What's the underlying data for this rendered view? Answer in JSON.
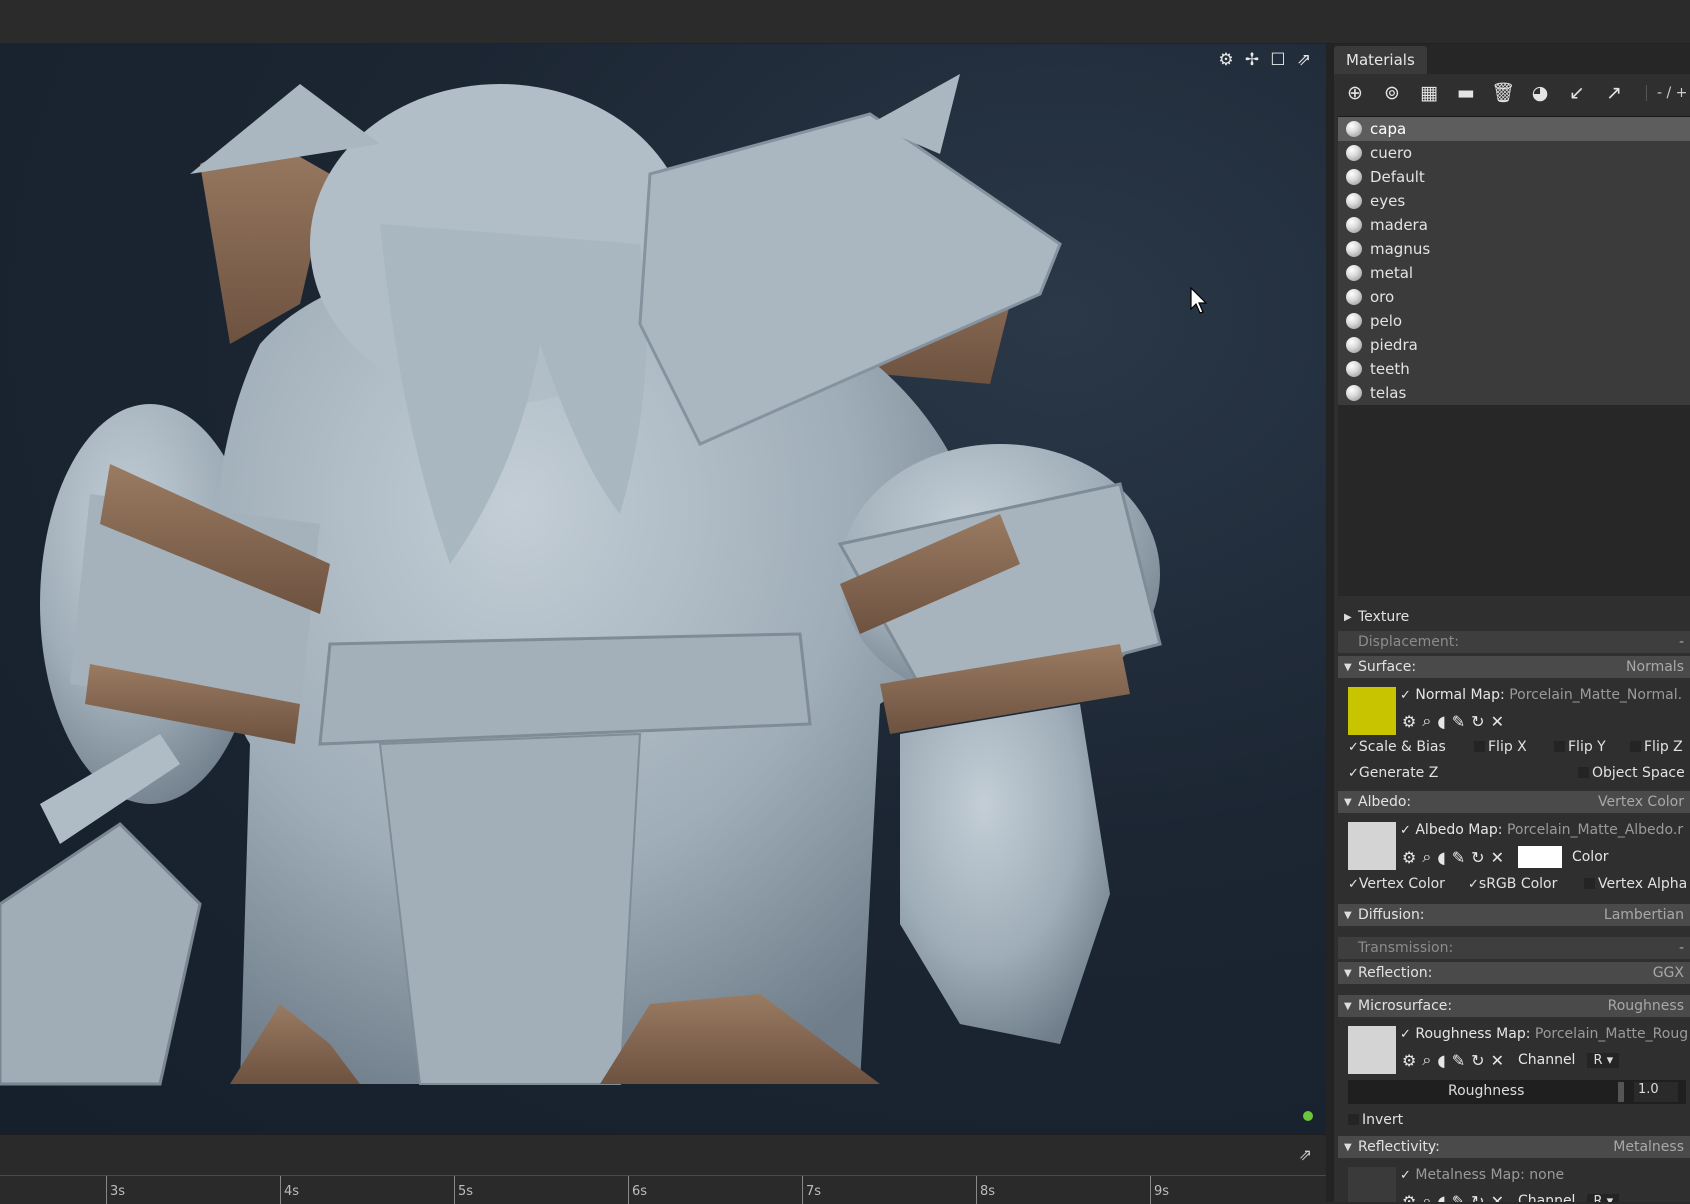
{
  "panel": {
    "tab": "Materials",
    "toolbar_icons": [
      "add-material-icon",
      "duplicate-icon",
      "checker-icon",
      "folder-icon",
      "delete-icon",
      "select-icon",
      "import-icon",
      "export-icon"
    ],
    "toolbar_count": "- / +"
  },
  "materials": [
    "capa",
    "cuero",
    "Default",
    "eyes",
    "madera",
    "magnus",
    "metal",
    "oro",
    "pelo",
    "piedra",
    "teeth",
    "telas"
  ],
  "selected_material": "capa",
  "sections": {
    "texture": "Texture",
    "displacement": {
      "label": "Displacement:",
      "value": "-"
    },
    "surface": {
      "label": "Surface:",
      "value": "Normals"
    },
    "normal_map": {
      "label": "Normal Map:",
      "file": "Porcelain_Matte_Normal.",
      "swatch": "#c8c400"
    },
    "scale_bias": "Scale & Bias",
    "flip_x": "Flip X",
    "flip_y": "Flip Y",
    "flip_z": "Flip Z",
    "generate_z": "Generate Z",
    "object_space": "Object Space",
    "albedo": {
      "label": "Albedo:",
      "value": "Vertex Color"
    },
    "albedo_map": {
      "label": "Albedo Map:",
      "file": "Porcelain_Matte_Albedo.r",
      "swatch": "#d4d4d4"
    },
    "color": "Color",
    "vertex_color": "Vertex Color",
    "srgb_color": "sRGB Color",
    "vertex_alpha": "Vertex Alpha",
    "diffusion": {
      "label": "Diffusion:",
      "value": "Lambertian"
    },
    "transmission": {
      "label": "Transmission:",
      "value": "-"
    },
    "reflection": {
      "label": "Reflection:",
      "value": "GGX"
    },
    "microsurface": {
      "label": "Microsurface:",
      "value": "Roughness"
    },
    "roughness_map": {
      "label": "Roughness Map:",
      "file": "Porcelain_Matte_Roug",
      "swatch": "#d4d4d4"
    },
    "channel": "Channel",
    "channel_value": "R",
    "roughness_label": "Roughness",
    "roughness_value": "1.0",
    "invert": "Invert",
    "reflectivity": {
      "label": "Reflectivity:",
      "value": "Metalness"
    },
    "metalness_map": {
      "label": "Metalness Map:",
      "file": "none"
    }
  },
  "timeline": {
    "labels": [
      "3s",
      "4s",
      "5s",
      "6s",
      "7s",
      "8s",
      "9s"
    ]
  }
}
